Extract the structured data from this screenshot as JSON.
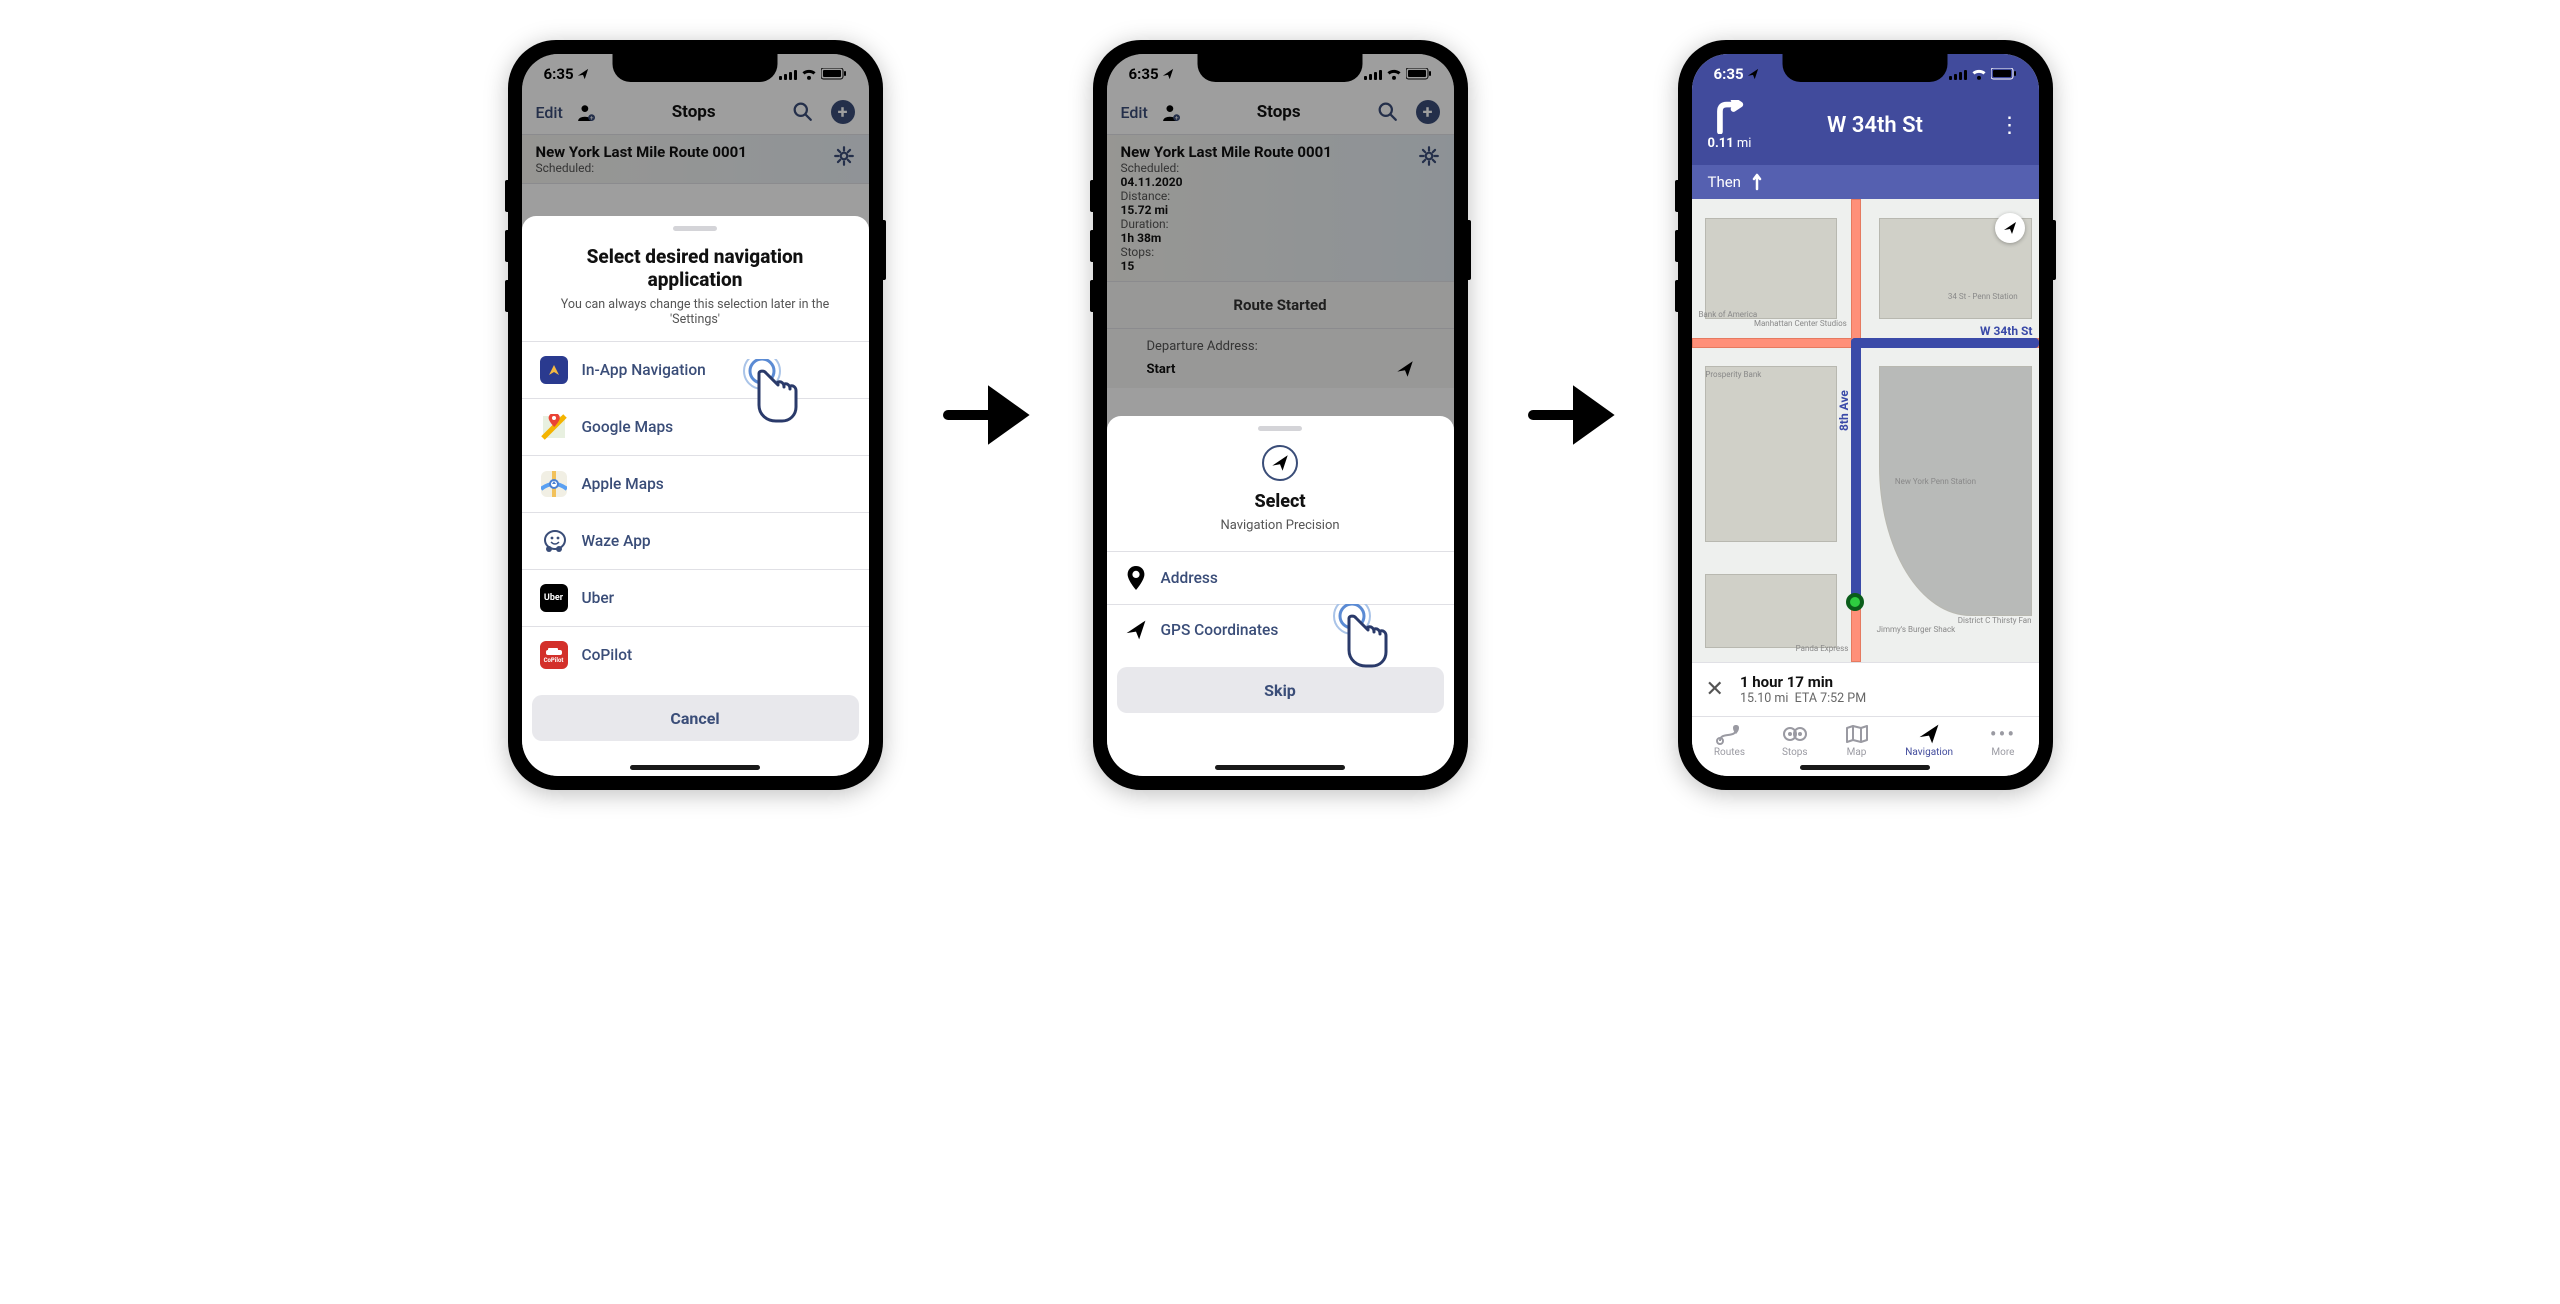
{
  "status": {
    "time": "6:35"
  },
  "phone1": {
    "header": {
      "edit": "Edit",
      "title": "Stops"
    },
    "route": {
      "name": "New York Last Mile Route 0001",
      "scheduled_label": "Scheduled:"
    },
    "sheet": {
      "title": "Select desired navigation application",
      "subtitle": "You can always change this selection later in the 'Settings'",
      "options": {
        "inapp": "In-App Navigation",
        "google": "Google Maps",
        "apple": "Apple Maps",
        "waze": "Waze App",
        "uber": "Uber",
        "copilot": "CoPilot"
      },
      "cancel": "Cancel"
    }
  },
  "phone2": {
    "header": {
      "edit": "Edit",
      "title": "Stops"
    },
    "route": {
      "name": "New York Last Mile Route 0001",
      "scheduled_label": "Scheduled:",
      "scheduled_value": "04.11.2020",
      "distance_label": "Distance:",
      "distance_value": "15.72 mi",
      "duration_label": "Duration:",
      "duration_value": "1h 38m",
      "stops_label": "Stops:",
      "stops_value": "15"
    },
    "started": "Route Started",
    "departure_label": "Departure Address:",
    "start": "Start",
    "sheet": {
      "title": "Select",
      "subtitle": "Navigation Precision",
      "address": "Address",
      "gps": "GPS Coordinates",
      "skip": "Skip"
    }
  },
  "phone3": {
    "nav": {
      "distance": "0.11",
      "distance_unit": "mi",
      "street": "W 34th St",
      "then": "Then"
    },
    "map": {
      "street_h": "W 34th St",
      "street_v": "8th Ave",
      "poi1": "Bank of America",
      "poi2": "Manhattan Center Studios",
      "poi3": "34 St - Penn Station",
      "poi4": "Prosperity Bank",
      "poi5": "New York Penn Station",
      "poi6": "Jimmy's Burger Shack",
      "poi7": "Panda Express",
      "poi8": "District C Thirsty Fan"
    },
    "eta": {
      "duration": "1 hour 17 min",
      "distance": "15.10 mi",
      "eta_label": "ETA 7:52 PM"
    },
    "tabs": {
      "routes": "Routes",
      "stops": "Stops",
      "map": "Map",
      "navigation": "Navigation",
      "more": "More"
    }
  }
}
